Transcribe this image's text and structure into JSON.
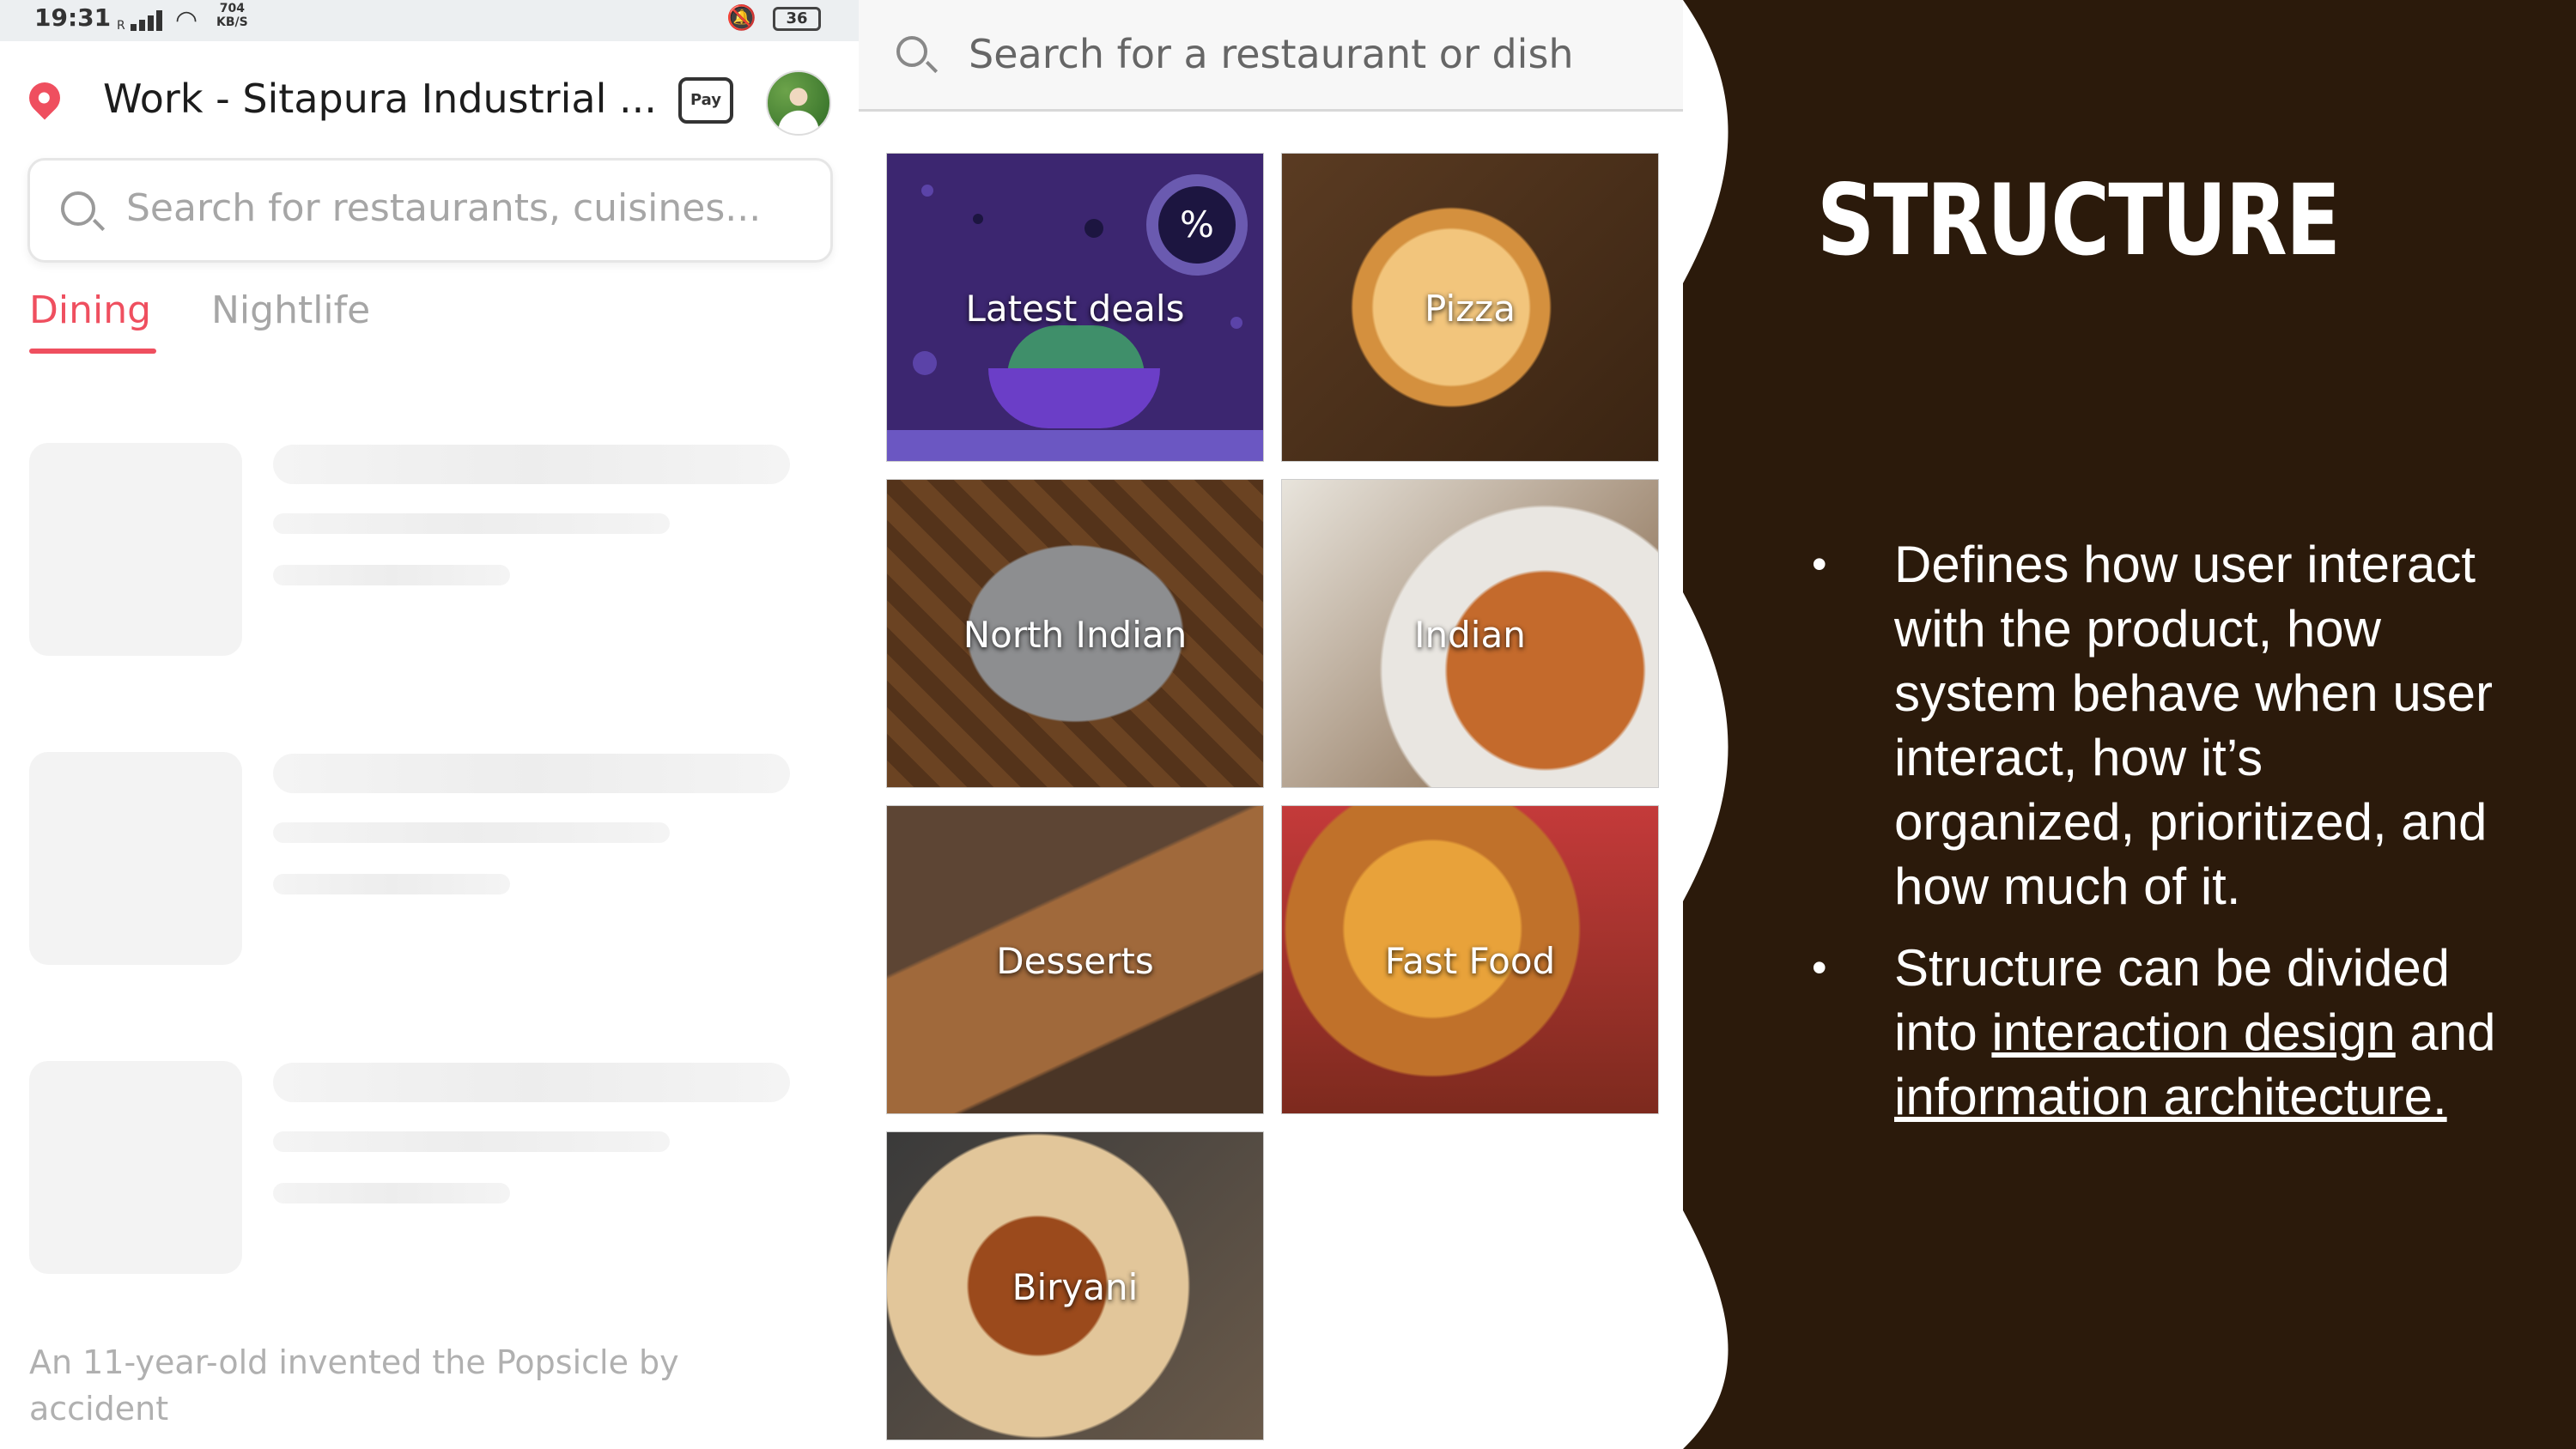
{
  "status_bar": {
    "time": "19:31",
    "signal": "R",
    "speed_value": "704",
    "speed_unit": "KB/S",
    "battery": "36"
  },
  "header": {
    "location": "Work - Sitapura Industrial ...",
    "pay_label": "Pay"
  },
  "left_search": {
    "placeholder": "Search for restaurants, cuisines..."
  },
  "tabs": [
    {
      "label": "Dining"
    },
    {
      "label": "Nightlife"
    }
  ],
  "fact": "An 11-year-old invented the Popsicle by accident",
  "grid_search": {
    "placeholder": "Search for a restaurant or dish"
  },
  "categories": [
    {
      "label": "Latest deals"
    },
    {
      "label": "Pizza"
    },
    {
      "label": "North Indian"
    },
    {
      "label": "Indian"
    },
    {
      "label": "Desserts"
    },
    {
      "label": "Fast Food"
    },
    {
      "label": "Biryani"
    }
  ],
  "slide": {
    "title": "STRUCTURE",
    "bullet1": "Defines how user interact with the product, how system behave when user interact, how it’s organized, prioritized, and how much of it.",
    "bullet2_prefix": "Structure can be divided into",
    "bullet2_link1": "interaction design",
    "bullet2_and": "and",
    "bullet2_link2": "information architecture.",
    "bullet_symbol": "•"
  },
  "colors": {
    "accent": "#ef4f5f",
    "slide_bg": "#2b1a0b",
    "deals_bg": "#3c2670"
  }
}
